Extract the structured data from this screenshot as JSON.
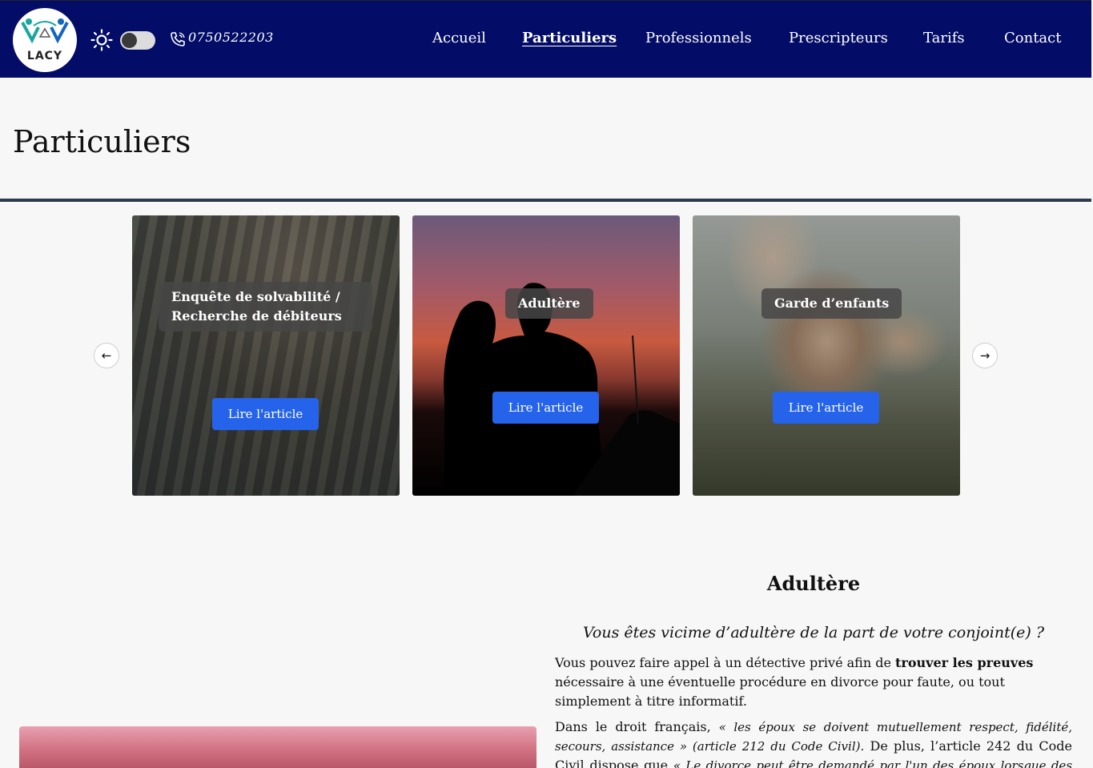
{
  "header": {
    "logo_text": "LACY",
    "phone": "0750522203",
    "nav": [
      {
        "label": "Accueil",
        "active": false
      },
      {
        "label": "Particuliers",
        "active": true
      },
      {
        "label": "Professionnels",
        "active": false
      },
      {
        "label": "Prescripteurs",
        "active": false
      },
      {
        "label": "Tarifs",
        "active": false
      },
      {
        "label": "Contact",
        "active": false
      }
    ],
    "colors": {
      "bar": "#030c66",
      "text": "#ffffff"
    }
  },
  "page": {
    "title": "Particuliers"
  },
  "carousel": {
    "prev_icon": "arrow-left-icon",
    "next_icon": "arrow-right-icon",
    "cards": [
      {
        "title_line1": "Enquête de solvabilité /",
        "title_line2": "Recherche de débiteurs",
        "button": "Lire l'article"
      },
      {
        "title_line1": "Adultère",
        "button": "Lire l'article"
      },
      {
        "title_line1": "Garde d’enfants",
        "button": "Lire l'article"
      }
    ],
    "button_color": "#2563eb"
  },
  "article": {
    "title": "Adultère",
    "lead": "Vous êtes vicime d’adultère de la part de votre conjoint(e) ?",
    "p1_before": "Vous pouvez faire appel à un détective privé afin de ",
    "p1_bold": "trouver les preuves",
    "p1_after": " nécessaire à une éventuelle procédure en divorce pour faute, ou tout simplement à titre informatif.",
    "p2_before": "Dans le droit français, ",
    "p2_quote": "« les époux se doivent mutuellement respect, fidélité, secours, assistance » (article 212 du Code Civil).",
    "p2_middle": " De plus, l’article 242 du Code Civil dispose que ",
    "p2_quote2": "« Le divorce peut être demandé par l'un des époux lorsque des faits"
  }
}
